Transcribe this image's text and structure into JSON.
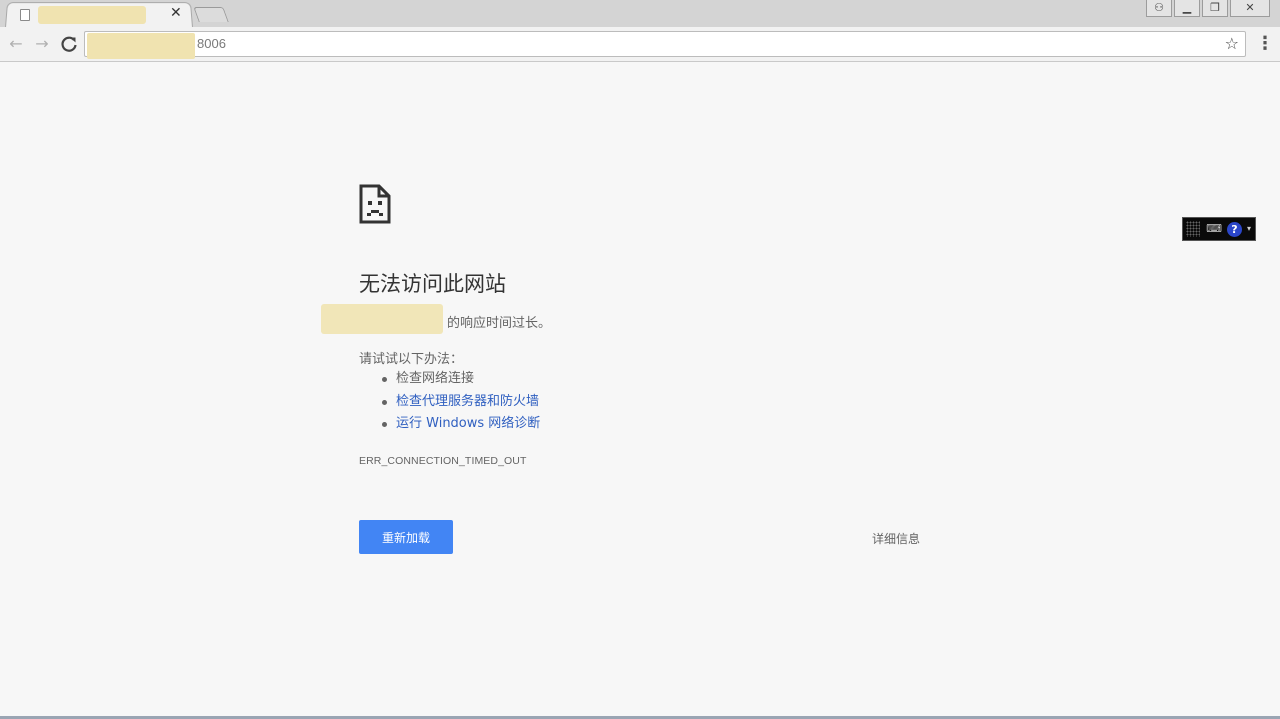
{
  "browser": {
    "tab": {
      "title": "",
      "close_glyph": "✕"
    },
    "window_controls": {
      "user_glyph": "⚇",
      "minimize_glyph": "▁",
      "restore_glyph": "❐",
      "close_glyph": "✕"
    },
    "nav": {
      "back_glyph": "←",
      "forward_glyph": "→",
      "reload_glyph": "C"
    },
    "address_bar": {
      "url_visible": "8006"
    },
    "bookmark_glyph": "☆",
    "menu_glyph": "⋮"
  },
  "error_page": {
    "title": "无法访问此网站",
    "reason": "的响应时间过长。",
    "suggestions_heading": "请试试以下办法：",
    "suggestions": [
      {
        "label": "检查网络连接",
        "is_link": false
      },
      {
        "label": "检查代理服务器和防火墙",
        "is_link": true
      },
      {
        "label": "运行 Windows 网络诊断",
        "is_link": true
      }
    ],
    "error_code": "ERR_CONNECTION_TIMED_OUT",
    "reload_label": "重新加载",
    "details_label": "详细信息"
  },
  "ime_toolbar": {
    "keyboard_glyph": "⌨",
    "help_glyph": "?",
    "arrow_glyph": "▾"
  },
  "colors": {
    "page_background": "#f7f7f7",
    "reload_button": "#4285f4",
    "link": "#2f5fc0",
    "redaction": "#f0e3b0"
  }
}
